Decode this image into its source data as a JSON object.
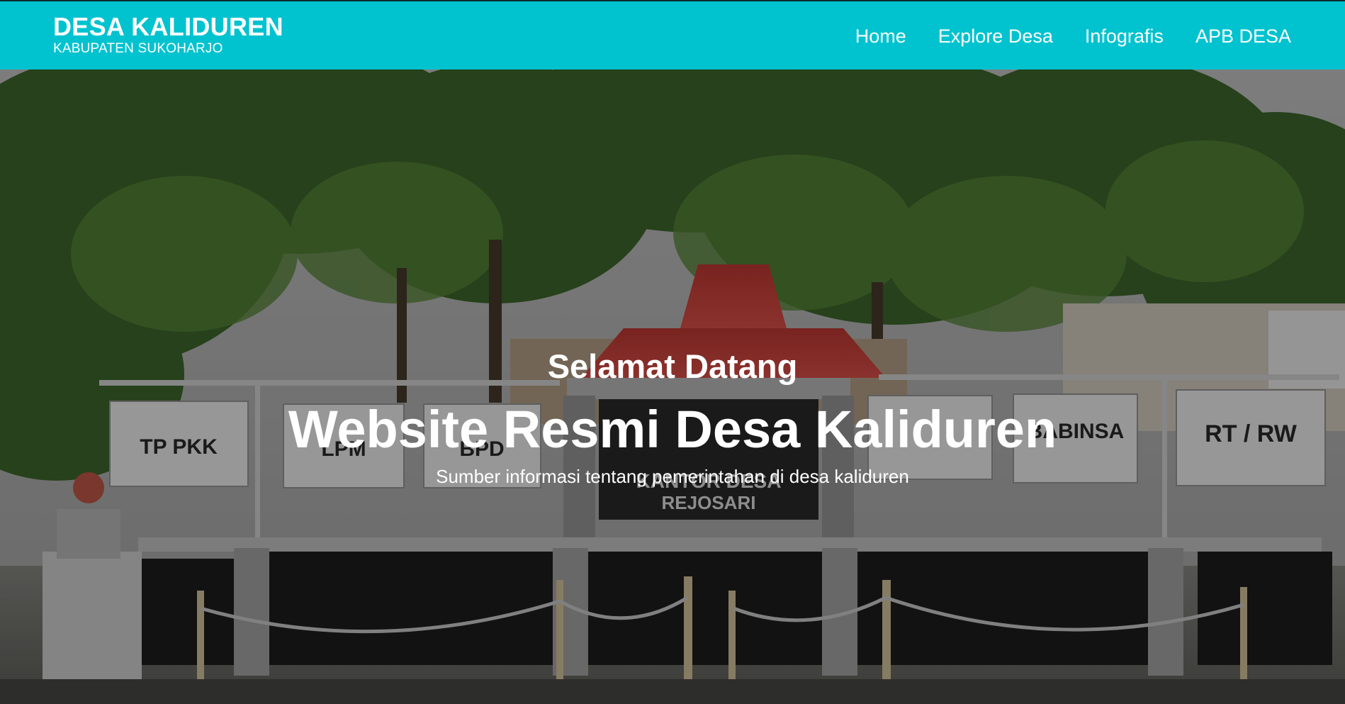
{
  "brand": {
    "title": "DESA KALIDUREN",
    "subtitle": "KABUPATEN SUKOHARJO"
  },
  "nav": {
    "items": [
      {
        "label": "Home"
      },
      {
        "label": "Explore Desa"
      },
      {
        "label": "Infografis"
      },
      {
        "label": "APB DESA"
      }
    ]
  },
  "hero": {
    "greeting": "Selamat Datang",
    "headline": "Website Resmi Desa Kaliduren",
    "subline": "Sumber informasi tentang pemerintahan di desa kaliduren",
    "signs": {
      "tp_pkk": "TP PKK",
      "lpm": "LPM",
      "bpd": "BPD",
      "babinsa": "BABINSA",
      "rt_rw": "RT / RW",
      "kantor": "KANTOR DESA",
      "kantor_name": "REJOSARI"
    }
  },
  "colors": {
    "navbar": "#01c3cf",
    "text": "#ffffff"
  }
}
